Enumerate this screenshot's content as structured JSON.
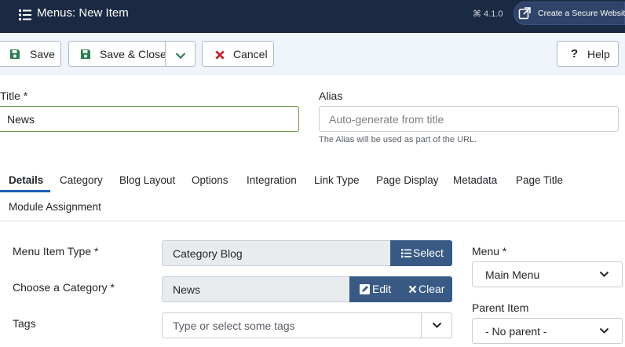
{
  "header": {
    "title": "Menus: New Item",
    "version": "⌘ 4.1.0",
    "secure_button": "Create a Secure Website"
  },
  "toolbar": {
    "save": "Save",
    "save_close": "Save & Close",
    "cancel": "Cancel",
    "help": "Help"
  },
  "form": {
    "title_label": "Title *",
    "title_value": "News",
    "alias_label": "Alias",
    "alias_placeholder": "Auto-generate from title",
    "alias_hint": "The Alias will be used as part of the URL."
  },
  "tabs": [
    "Details",
    "Category",
    "Blog Layout",
    "Options",
    "Integration",
    "Link Type",
    "Page Display",
    "Metadata",
    "Page Title",
    "Module Assignment"
  ],
  "details": {
    "menu_item_type_label": "Menu Item Type *",
    "menu_item_type_value": "Category Blog",
    "select_button": "Select",
    "category_label": "Choose a Category *",
    "category_value": "News",
    "edit_button": "Edit",
    "clear_button": "Clear",
    "tags_label": "Tags",
    "tags_placeholder": "Type or select some tags",
    "menu_label": "Menu *",
    "menu_value": "Main Menu",
    "parent_label": "Parent Item",
    "parent_value": "- No parent -"
  },
  "colors": {
    "header_bg": "#1b2a43",
    "toolbar_bg": "#f0f4fb",
    "accent": "#3a5a86",
    "save_green": "#2a7d4f",
    "cancel_red": "#c0262c"
  }
}
